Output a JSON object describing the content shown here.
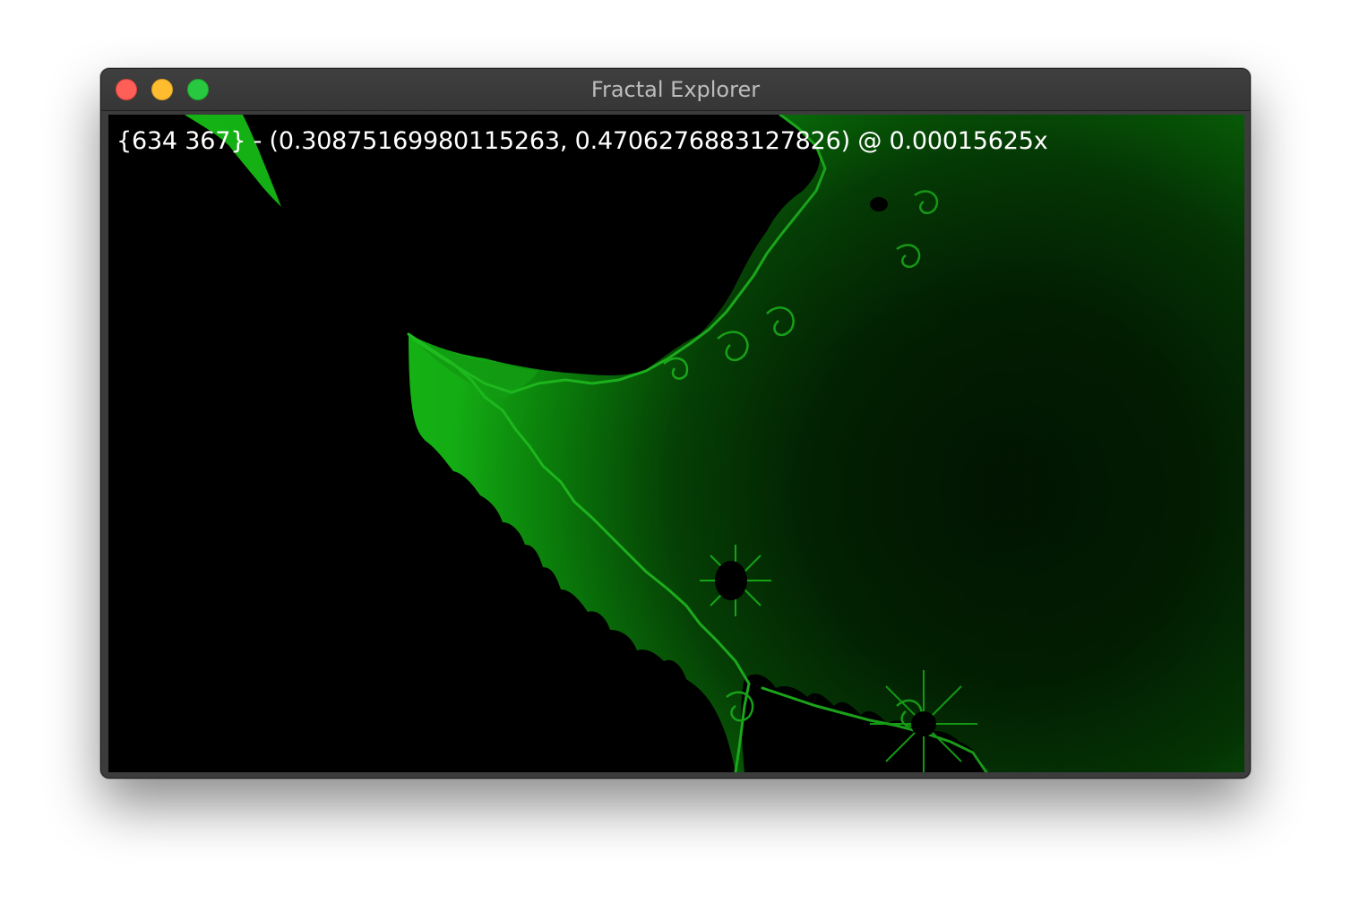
{
  "window": {
    "title": "Fractal Explorer"
  },
  "viewport": {
    "coordinate_readout": "{634 367} - (0.30875169980115263, 0.4706276883127826) @ 0.00015625x"
  },
  "colors": {
    "background": "#000000",
    "fractal_edge": "#19c419",
    "fractal_mid": "#0a7a0a",
    "fractal_deep": "#022802",
    "text": "#ffffff"
  }
}
